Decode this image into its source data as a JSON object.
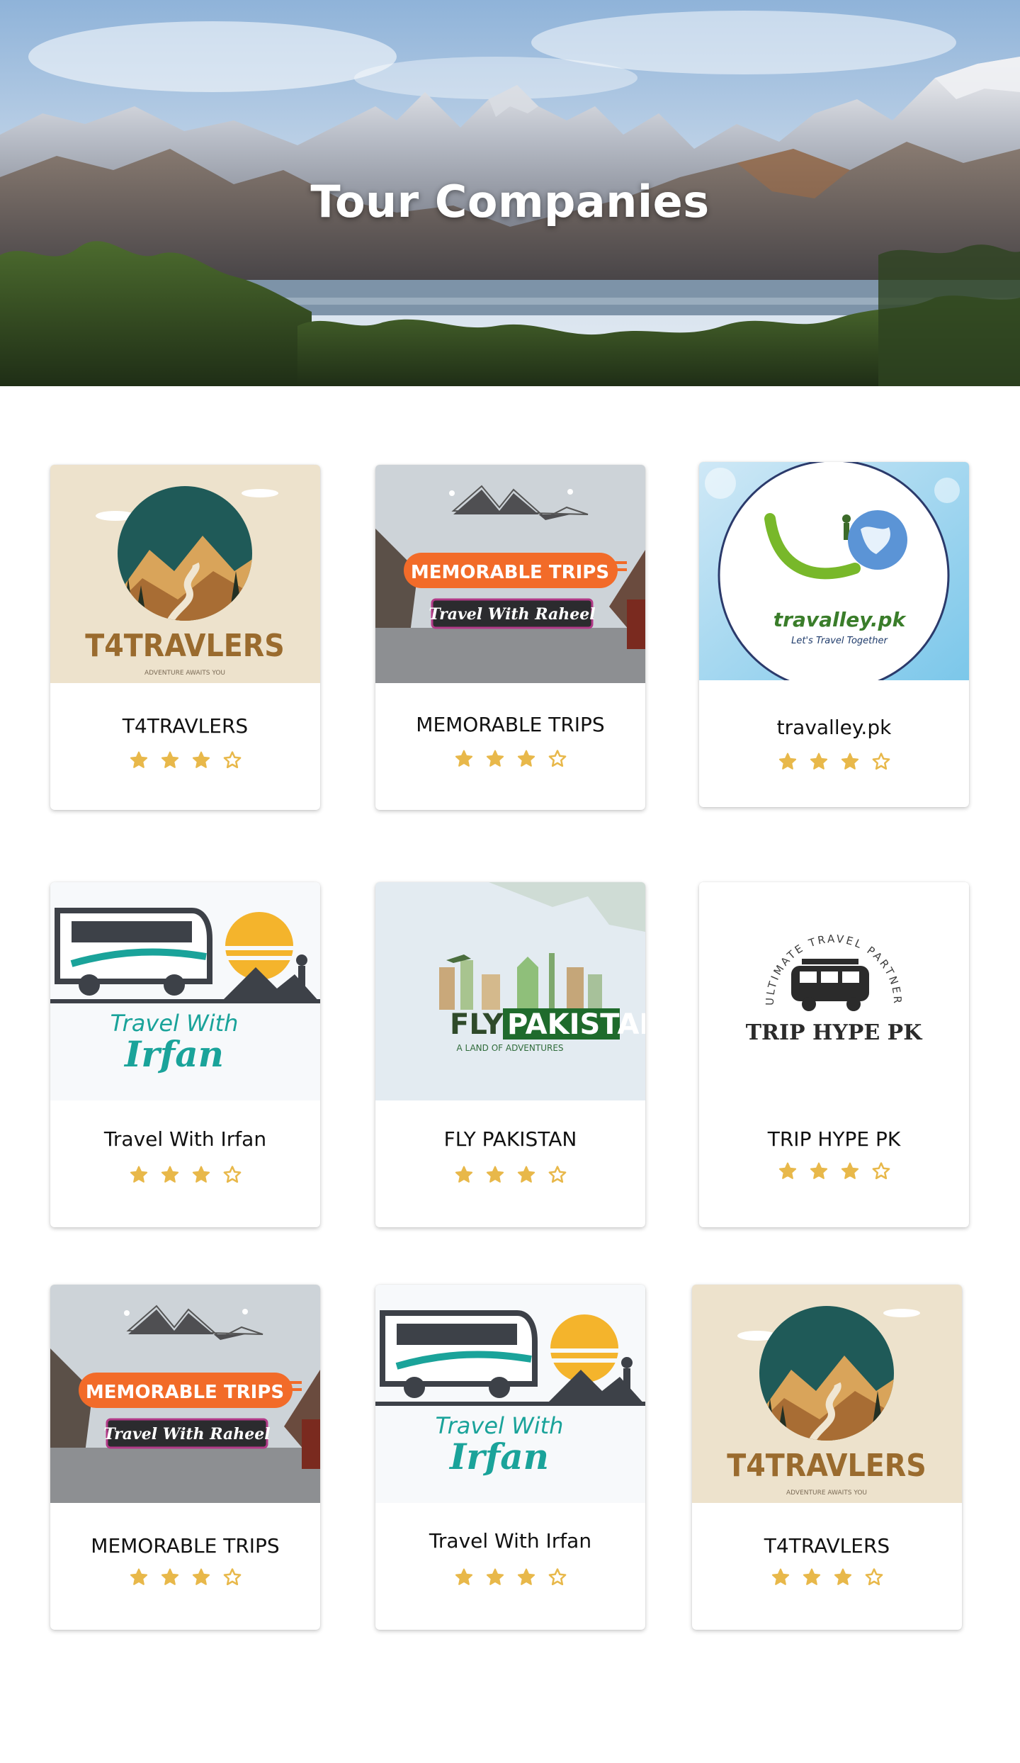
{
  "hero": {
    "title": "Tour Companies"
  },
  "colors": {
    "star": "#E8B84A",
    "text": "#111111"
  },
  "companies": [
    {
      "name": "T4TRAVLERS",
      "logo": "t4travlers-logo",
      "logo_text": "T4TRAVLERS",
      "tagline": "ADVENTURE AWAITS YOU",
      "rating": 3,
      "max_rating": 4
    },
    {
      "name": "MEMORABLE TRIPS",
      "logo": "memorable-trips-logo",
      "logo_text": "MEMORABLE TRIPS",
      "tagline": "Travel With Raheel",
      "rating": 3,
      "max_rating": 4
    },
    {
      "name": "travalley.pk",
      "logo": "travalley-logo",
      "logo_text": "travalley.pk",
      "tagline": "Let's Travel Together",
      "rating": 3,
      "max_rating": 4
    },
    {
      "name": "Travel With Irfan",
      "logo": "travel-with-irfan-logo",
      "logo_text": "Travel With",
      "tagline": "Irfan",
      "rating": 3,
      "max_rating": 4
    },
    {
      "name": "FLY PAKISTAN",
      "logo": "fly-pakistan-logo",
      "logo_text": "FLY PAKISTAN",
      "tagline": "A LAND OF ADVENTURES",
      "rating": 3,
      "max_rating": 4
    },
    {
      "name": "TRIP HYPE PK",
      "logo": "trip-hype-logo",
      "logo_text": "TRIP HYPE PK",
      "tagline": "ULTIMATE TRAVEL PARTNER",
      "rating": 3,
      "max_rating": 4
    },
    {
      "name": "MEMORABLE TRIPS",
      "logo": "memorable-trips-logo",
      "logo_text": "MEMORABLE TRIPS",
      "tagline": "Travel With Raheel",
      "rating": 3,
      "max_rating": 4
    },
    {
      "name": "Travel With Irfan",
      "logo": "travel-with-irfan-logo",
      "logo_text": "Travel With",
      "tagline": "Irfan",
      "rating": 3,
      "max_rating": 4
    },
    {
      "name": "T4TRAVLERS",
      "logo": "t4travlers-logo",
      "logo_text": "T4TRAVLERS",
      "tagline": "ADVENTURE AWAITS YOU",
      "rating": 3,
      "max_rating": 4
    }
  ]
}
